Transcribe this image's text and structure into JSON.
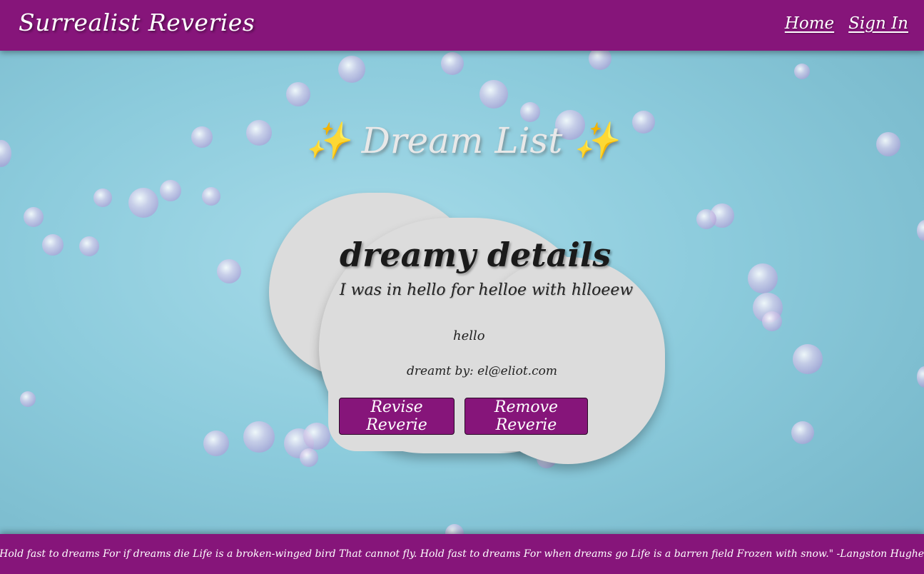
{
  "nav": {
    "brand": "Surrealist Reveries",
    "links": [
      "Home",
      "Sign In"
    ]
  },
  "page": {
    "title": "Dream List",
    "sparkle_icon": "sparkles-icon"
  },
  "dream": {
    "heading": "dreamy details",
    "description": "I was in hello for helloe with hlloeew",
    "body": "hello",
    "author": "dreamt by: el@eliot.com"
  },
  "actions": {
    "revise_label": "Revise Reverie",
    "remove_label": "Remove Reverie"
  },
  "footer": {
    "quote": "\"Hold fast to dreams For if dreams die Life is a broken-winged bird That cannot fly. Hold fast to dreams For when dreams go Life is a barren field Frozen with snow.\" -Langston Hughes"
  },
  "colors": {
    "brand_purple": "#86157a",
    "card_gray": "#dcdcdc",
    "background_blue": "#8ccbdc"
  }
}
